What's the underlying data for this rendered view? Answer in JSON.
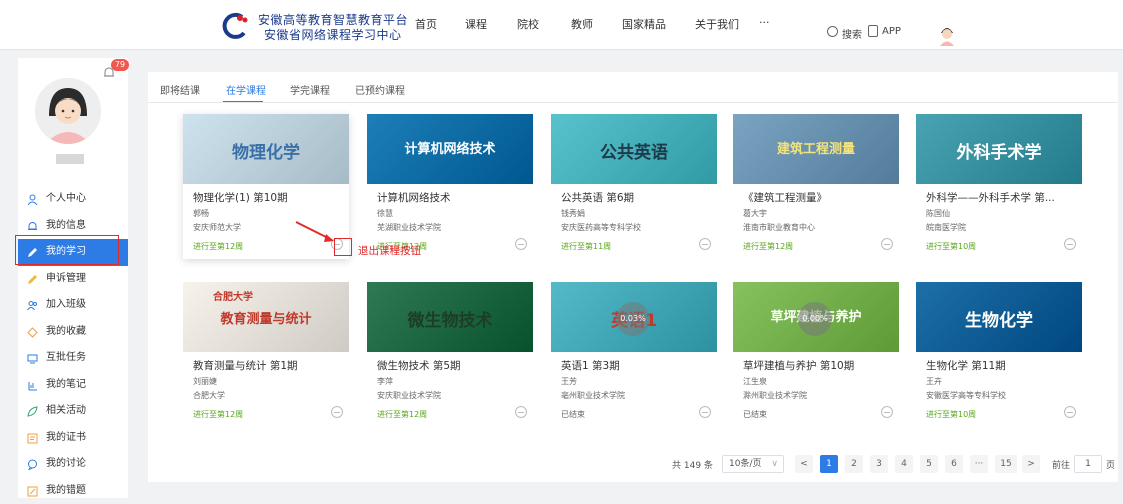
{
  "header": {
    "logo_line1": "安徽高等教育智慧教育平台",
    "logo_line2": "安徽省网络课程学习中心",
    "nav": [
      "首页",
      "课程",
      "院校",
      "教师",
      "国家精品",
      "关于我们",
      "···"
    ],
    "search_label": "搜索",
    "app_label": "APP"
  },
  "sidebar": {
    "notification_count": "79",
    "menu": [
      {
        "label": "个人中心",
        "icon": "user-icon"
      },
      {
        "label": "我的信息",
        "icon": "bell-icon"
      },
      {
        "label": "我的学习",
        "icon": "pencil-icon",
        "active": true
      },
      {
        "label": "申诉管理",
        "icon": "pencil-icon"
      },
      {
        "label": "加入班级",
        "icon": "group-icon"
      },
      {
        "label": "我的收藏",
        "icon": "diamond-icon"
      },
      {
        "label": "互批任务",
        "icon": "screen-icon"
      },
      {
        "label": "我的笔记",
        "icon": "chart-icon"
      },
      {
        "label": "相关活动",
        "icon": "leaf-icon"
      },
      {
        "label": "我的证书",
        "icon": "certificate-icon"
      },
      {
        "label": "我的讨论",
        "icon": "chat-icon"
      },
      {
        "label": "我的错题",
        "icon": "edit-icon"
      }
    ]
  },
  "tabs": [
    "即将结课",
    "在学课程",
    "学完课程",
    "已预约课程"
  ],
  "active_tab": "在学课程",
  "courses": [
    {
      "title": "物理化学(1) 第10期",
      "teacher": "郭畅",
      "school": "安庆师范大学",
      "status": "进行至第12周",
      "thumb_text": "物理化学",
      "thumb_color": "#cfe3ef",
      "thumb_text_color": "#3b6fa8"
    },
    {
      "title": "计算机网络技术",
      "teacher": "徐慧",
      "school": "芜湖职业技术学院",
      "status": "进行至第12周",
      "thumb_text": "计算机网络技术",
      "thumb_color": "#1d7fb8",
      "thumb_text_color": "#ffffff"
    },
    {
      "title": "公共英语 第6期",
      "teacher": "钱秀娟",
      "school": "安庆医药高等专科学校",
      "status": "进行至第11周",
      "thumb_text": "公共英语",
      "thumb_color": "#58c3cc",
      "thumb_text_color": "#1e3a4a"
    },
    {
      "title": "《建筑工程测量》",
      "teacher": "葛大宇",
      "school": "淮南市职业教育中心",
      "status": "进行至第12周",
      "thumb_text": "建筑工程测量",
      "thumb_color": "#7aa4c2",
      "thumb_text_color": "#f4e37a"
    },
    {
      "title": "外科学——外科手术学 第...",
      "teacher": "陈国仙",
      "school": "皖南医学院",
      "status": "进行至第10周",
      "thumb_text": "外科手术学",
      "thumb_color": "#4aa3b3",
      "thumb_text_color": "#ffffff"
    },
    {
      "title": "教育测量与统计 第1期",
      "teacher": "刘丽婕",
      "school": "合肥大学",
      "status": "进行至第12周",
      "thumb_text": "教育测量与统计",
      "thumb_color": "#f7f3ec",
      "thumb_text_color": "#c0392b",
      "thumb_brand": "合肥大学"
    },
    {
      "title": "微生物技术 第5期",
      "teacher": "李萍",
      "school": "安庆职业技术学院",
      "status": "进行至第12周",
      "thumb_text": "微生物技术",
      "thumb_color": "#2f7a55",
      "thumb_text_color": "#1e3c2a"
    },
    {
      "title": "英语1 第3期",
      "teacher": "王芳",
      "school": "亳州职业技术学院",
      "status": "已结束",
      "thumb_text": "英语1",
      "thumb_color": "#54b9c8",
      "thumb_text_color": "#c0392b",
      "progress": "0.03%"
    },
    {
      "title": "草坪建植与养护 第10期",
      "teacher": "江生泉",
      "school": "滁州职业技术学院",
      "status": "已结束",
      "thumb_text": "草坪建植与养护",
      "thumb_color": "#86c25e",
      "thumb_text_color": "#ffffff",
      "progress": "0.00%"
    },
    {
      "title": "生物化学 第11期",
      "teacher": "王卉",
      "school": "安徽医学高等专科学校",
      "status": "进行至第10周",
      "thumb_text": "生物化学",
      "thumb_color": "#1e6fa8",
      "thumb_text_color": "#ffffff"
    }
  ],
  "annotation": "退出课程按钮",
  "pagination": {
    "total": "共 149 条",
    "page_size": "10条/页",
    "pages": [
      "1",
      "2",
      "3",
      "4",
      "5",
      "6",
      "···",
      "15"
    ],
    "current_page": "1",
    "goto_label": "前往",
    "goto_value": "1",
    "goto_suffix": "页"
  }
}
